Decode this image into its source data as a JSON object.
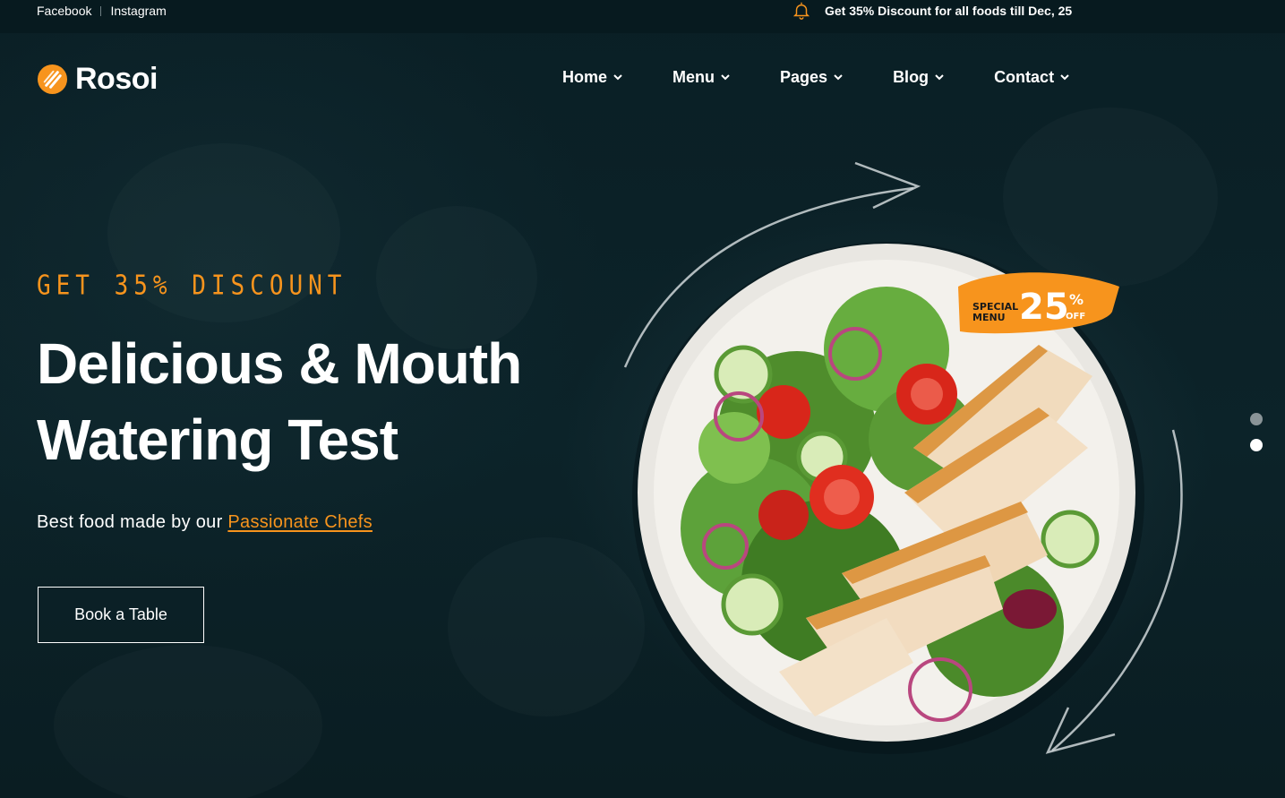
{
  "topbar": {
    "social": [
      {
        "label": "Facebook"
      },
      {
        "label": "Instagram"
      }
    ],
    "announcement": "Get 35% Discount for all foods till Dec, 25",
    "announcement_icon": "bell-icon"
  },
  "header": {
    "logo_text": "Rosoi",
    "logo_icon": "fork-circle-icon",
    "nav": [
      {
        "label": "Home"
      },
      {
        "label": "Menu"
      },
      {
        "label": "Pages"
      },
      {
        "label": "Blog"
      },
      {
        "label": "Contact"
      }
    ]
  },
  "hero": {
    "eyebrow": "GET 35% DISCOUNT",
    "headline_line1": "Delicious & Mouth",
    "headline_line2": "Watering Test",
    "subline_prefix": "Best food made by our ",
    "subline_link": "Passionate Chefs",
    "cta_label": "Book a Table"
  },
  "badge": {
    "line1": "SPECIAL",
    "line2": "MENU",
    "value": "25",
    "percent": "%",
    "suffix": "OFF"
  },
  "slider": {
    "count": 2,
    "active_index": 1
  },
  "colors": {
    "accent": "#f7941d",
    "background": "#0b2127",
    "topbar": "#071a1f",
    "text": "#ffffff",
    "dot_inactive": "#8a9497"
  }
}
